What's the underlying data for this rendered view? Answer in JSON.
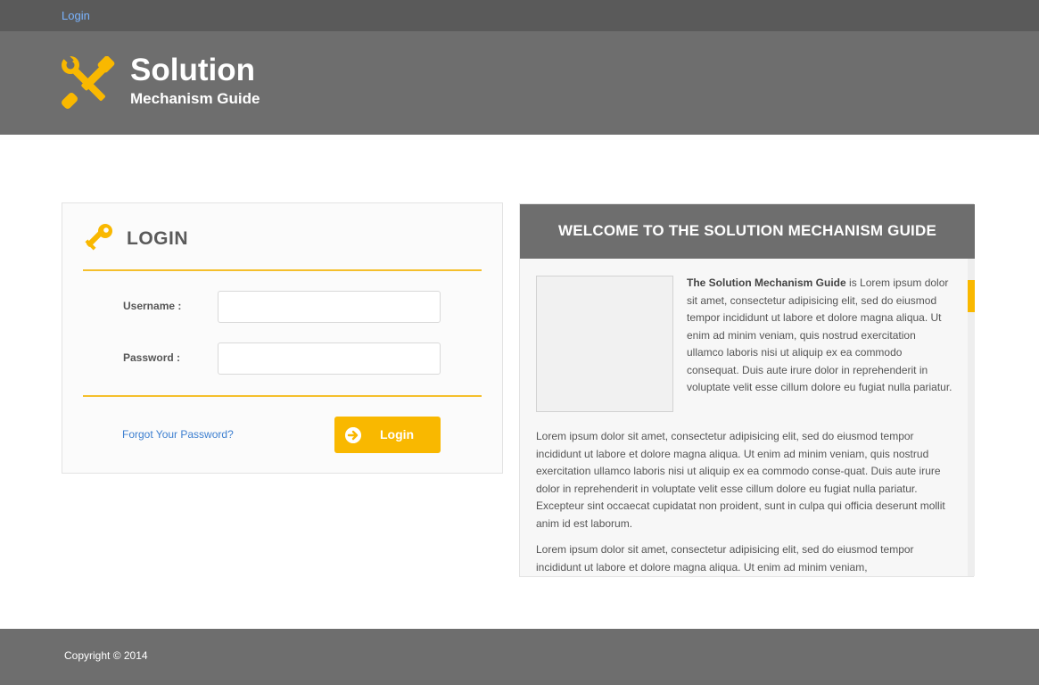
{
  "topbar": {
    "login_link": "Login"
  },
  "brand": {
    "title": "Solution",
    "subtitle": "Mechanism Guide",
    "logo_icon": "wrench-screwdriver-icon"
  },
  "login": {
    "title": "LOGIN",
    "icon": "key-icon",
    "username_label": "Username :",
    "username_value": "",
    "password_label": "Password :",
    "password_value": "",
    "forgot_link": "Forgot Your Password?",
    "button_label": "Login",
    "button_icon": "arrow-right-circle-icon"
  },
  "welcome": {
    "title": "WELCOME TO THE SOLUTION MECHANISM GUIDE",
    "intro_bold": "The Solution Mechanism Guide",
    "intro_text": " is Lorem ipsum dolor sit amet, consectetur adipisicing elit, sed do eiusmod tempor incididunt ut labore et dolore magna aliqua. Ut enim ad minim veniam, quis nostrud exercitation ullamco laboris nisi ut aliquip ex ea commodo consequat. Duis aute irure dolor in reprehenderit in voluptate velit esse cillum dolore eu fugiat nulla pariatur.",
    "paragraph_1": "Lorem ipsum dolor sit amet, consectetur adipisicing elit, sed do eiusmod tempor incididunt ut labore et dolore magna aliqua. Ut enim ad minim veniam, quis nostrud exercitation ullamco laboris nisi ut aliquip ex ea commodo conse-quat. Duis aute irure dolor in reprehenderit in voluptate velit esse cillum dolore eu fugiat nulla pariatur. Excepteur sint occaecat cupidatat non proident, sunt in culpa qui officia deserunt mollit anim id est laborum.",
    "paragraph_2": "Lorem ipsum dolor sit amet, consectetur adipisicing elit, sed do eiusmod tempor incididunt ut labore et dolore magna aliqua. Ut enim ad minim veniam,"
  },
  "footer": {
    "copyright": "Copyright © 2014"
  },
  "colors": {
    "accent": "#f9b800",
    "header": "#6e6e6e",
    "topbar": "#5a5a5a",
    "link": "#3d7fd0"
  }
}
